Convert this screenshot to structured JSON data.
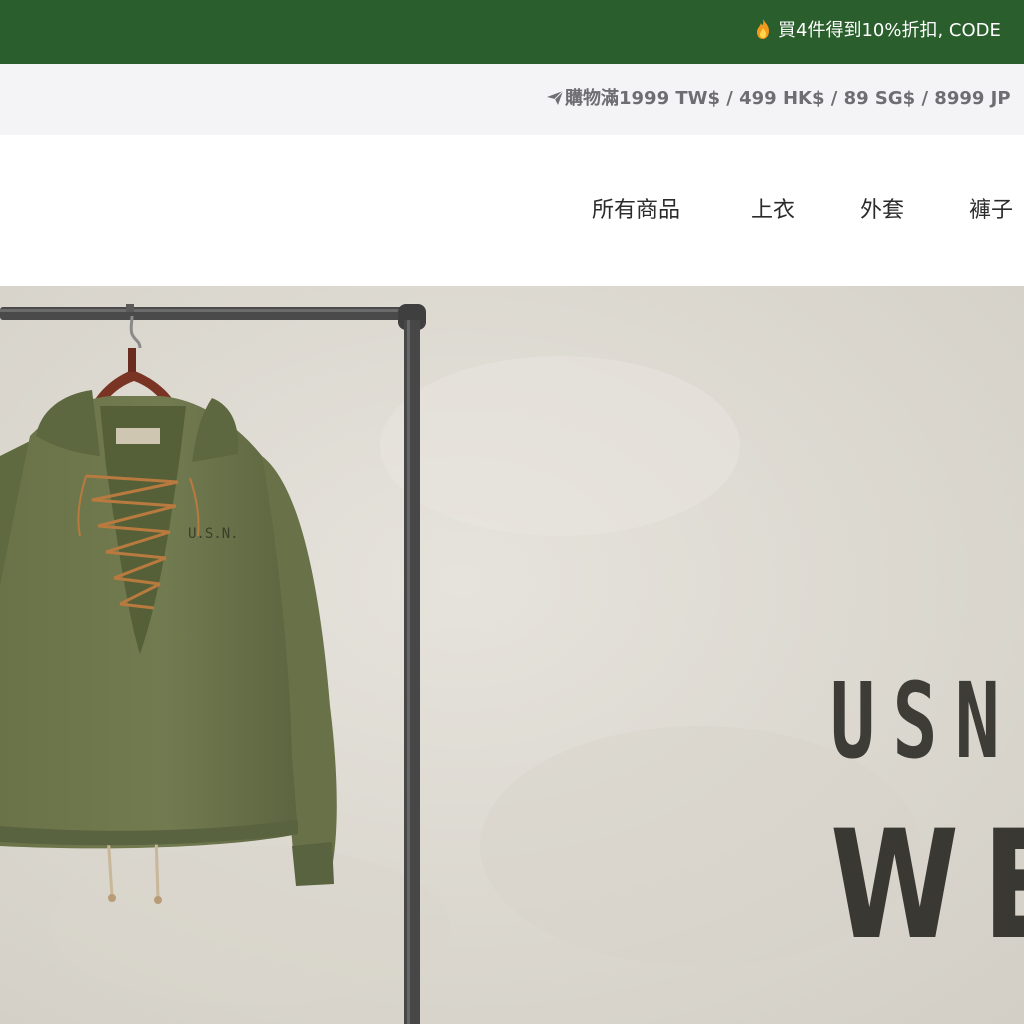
{
  "promo": {
    "icon": "fire-icon",
    "text": "買4件得到10%折扣, CODE"
  },
  "shipping": {
    "icon": "airplane-icon",
    "text": "購物滿1999 TW$ / 499 HK$ / 89 SG$ / 8999 JP"
  },
  "nav": {
    "items": [
      {
        "label": "所有商品"
      },
      {
        "label": "上衣"
      },
      {
        "label": "外套"
      },
      {
        "label": "褲子"
      }
    ]
  },
  "hero": {
    "title_line1": "USN",
    "title_line2": "WE"
  },
  "colors": {
    "promo_bg": "#2a5e2c",
    "shipping_bg": "#f4f4f6",
    "hero_bg": "#dedbd4",
    "garment": "#6b7449"
  }
}
